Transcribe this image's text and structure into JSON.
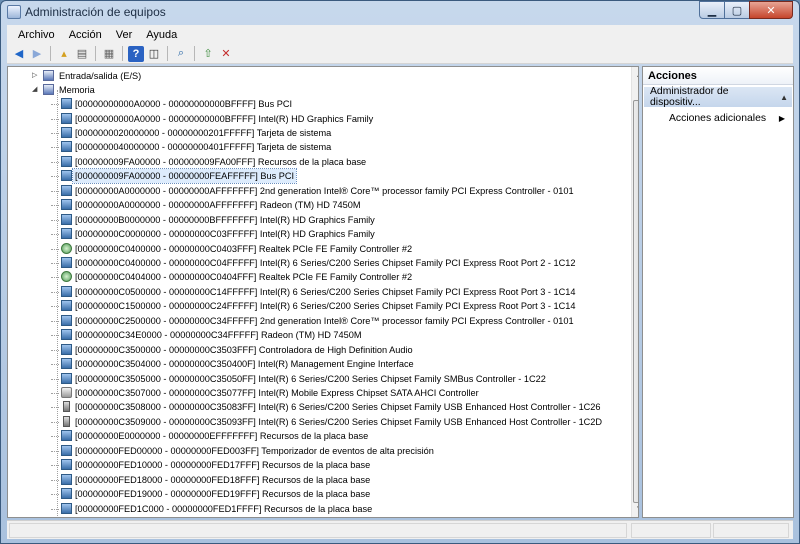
{
  "window": {
    "title": "Administración de equipos"
  },
  "menu": [
    "Archivo",
    "Acción",
    "Ver",
    "Ayuda"
  ],
  "toolbar_icons": [
    "back-arrow-icon",
    "forward-arrow-icon",
    "up-folder-icon",
    "console-tree-icon",
    "properties-icon",
    "help-icon",
    "show-hide-icon",
    "scan-hardware-icon",
    "update-driver-icon",
    "uninstall-icon"
  ],
  "tree": {
    "nodes": [
      {
        "label": "Entrada/salida (E/S)",
        "depth": 0,
        "state": "collapsed"
      },
      {
        "label": "Memoria",
        "depth": 0,
        "state": "expanded"
      }
    ],
    "rows": [
      {
        "range": "[00000000000A0000 - 00000000000BFFFF]",
        "name": "Bus PCI",
        "icon": "pci"
      },
      {
        "range": "[00000000000A0000 - 00000000000BFFFF]",
        "name": "Intel(R) HD Graphics Family",
        "icon": "display"
      },
      {
        "range": "[0000000020000000 - 00000000201FFFFF]",
        "name": "Tarjeta de sistema",
        "icon": "pci"
      },
      {
        "range": "[0000000040000000 - 00000000401FFFFF]",
        "name": "Tarjeta de sistema",
        "icon": "pci"
      },
      {
        "range": "[000000009FA00000 - 000000009FA00FFF]",
        "name": "Recursos de la placa base",
        "icon": "pci"
      },
      {
        "range": "[000000009FA00000 - 00000000FEAFFFFF]",
        "name": "Bus PCI",
        "icon": "pci",
        "selected": true
      },
      {
        "range": "[00000000A0000000 - 00000000AFFFFFFF]",
        "name": "2nd generation Intel® Core™ processor family PCI Express Controller - 0101",
        "icon": "pci"
      },
      {
        "range": "[00000000A0000000 - 00000000AFFFFFFF]",
        "name": "Radeon (TM) HD 7450M",
        "icon": "display"
      },
      {
        "range": "[00000000B0000000 - 00000000BFFFFFFF]",
        "name": "Intel(R) HD Graphics Family",
        "icon": "display"
      },
      {
        "range": "[00000000C0000000 - 00000000C03FFFFF]",
        "name": "Intel(R) HD Graphics Family",
        "icon": "display"
      },
      {
        "range": "[00000000C0400000 - 00000000C0403FFF]",
        "name": "Realtek PCIe FE Family Controller #2",
        "icon": "net"
      },
      {
        "range": "[00000000C0400000 - 00000000C04FFFFF]",
        "name": "Intel(R) 6 Series/C200 Series Chipset Family PCI Express Root Port 2 - 1C12",
        "icon": "pci"
      },
      {
        "range": "[00000000C0404000 - 00000000C0404FFF]",
        "name": "Realtek PCIe FE Family Controller #2",
        "icon": "net"
      },
      {
        "range": "[00000000C0500000 - 00000000C14FFFFF]",
        "name": "Intel(R) 6 Series/C200 Series Chipset Family PCI Express Root Port 3 - 1C14",
        "icon": "pci"
      },
      {
        "range": "[00000000C1500000 - 00000000C24FFFFF]",
        "name": "Intel(R) 6 Series/C200 Series Chipset Family PCI Express Root Port 3 - 1C14",
        "icon": "pci"
      },
      {
        "range": "[00000000C2500000 - 00000000C34FFFFF]",
        "name": "2nd generation Intel® Core™ processor family PCI Express Controller - 0101",
        "icon": "pci"
      },
      {
        "range": "[00000000C34E0000 - 00000000C34FFFFF]",
        "name": "Radeon (TM) HD 7450M",
        "icon": "display"
      },
      {
        "range": "[00000000C3500000 - 00000000C3503FFF]",
        "name": "Controladora de High Definition Audio",
        "icon": "pci"
      },
      {
        "range": "[00000000C3504000 - 00000000C350400F]",
        "name": "Intel(R) Management Engine Interface",
        "icon": "pci"
      },
      {
        "range": "[00000000C3505000 - 00000000C35050FF]",
        "name": "Intel(R) 6 Series/C200 Series Chipset Family SMBus Controller - 1C22",
        "icon": "pci"
      },
      {
        "range": "[00000000C3507000 - 00000000C35077FF]",
        "name": "Intel(R) Mobile Express Chipset SATA AHCI Controller",
        "icon": "ide"
      },
      {
        "range": "[00000000C3508000 - 00000000C35083FF]",
        "name": "Intel(R) 6 Series/C200 Series Chipset Family USB Enhanced Host Controller - 1C26",
        "icon": "usb"
      },
      {
        "range": "[00000000C3509000 - 00000000C35093FF]",
        "name": "Intel(R) 6 Series/C200 Series Chipset Family USB Enhanced Host Controller - 1C2D",
        "icon": "usb"
      },
      {
        "range": "[00000000E0000000 - 00000000EFFFFFFF]",
        "name": "Recursos de la placa base",
        "icon": "pci"
      },
      {
        "range": "[00000000FED00000 - 00000000FED003FF]",
        "name": "Temporizador de eventos de alta precisión",
        "icon": "pci"
      },
      {
        "range": "[00000000FED10000 - 00000000FED17FFF]",
        "name": "Recursos de la placa base",
        "icon": "pci"
      },
      {
        "range": "[00000000FED18000 - 00000000FED18FFF]",
        "name": "Recursos de la placa base",
        "icon": "pci"
      },
      {
        "range": "[00000000FED19000 - 00000000FED19FFF]",
        "name": "Recursos de la placa base",
        "icon": "pci"
      },
      {
        "range": "[00000000FED1C000 - 00000000FED1FFFF]",
        "name": "Recursos de la placa base",
        "icon": "pci"
      }
    ]
  },
  "actions": {
    "header": "Acciones",
    "section": "Administrador de dispositiv...",
    "sub": "Acciones adicionales"
  }
}
